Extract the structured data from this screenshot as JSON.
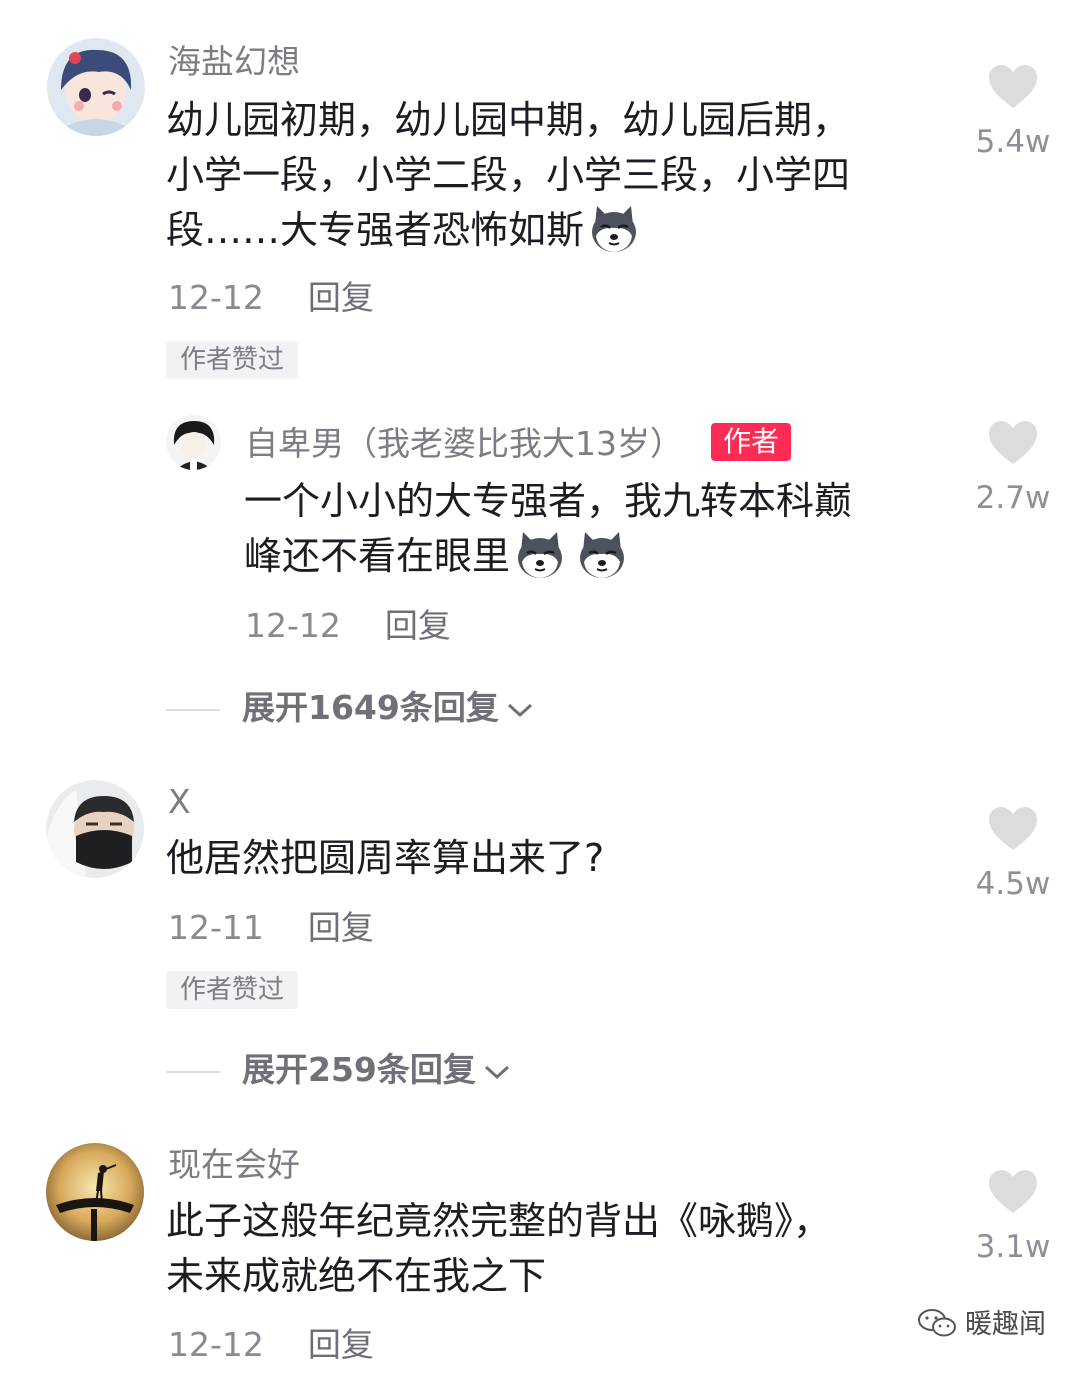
{
  "comments": [
    {
      "username": "海盐幻想",
      "line1": "幼儿园初期，幼儿园中期，幼儿园后期，",
      "line2": "小学一段，小学二段，小学三段，小学四",
      "line3": "段……大专强者恐怖如斯",
      "date": "12-12",
      "reply": "回复",
      "badge": "作者赞过",
      "likes": "5.4w",
      "emoji": "dog-emoji"
    },
    {
      "username": "自卑男（我老婆比我大13岁）",
      "author_tag": "作者",
      "line1": "一个小小的大专强者，我九转本科巅",
      "line2": "峰还不看在眼里",
      "date": "12-12",
      "reply": "回复",
      "likes": "2.7w",
      "emoji": "dog-emoji"
    },
    {
      "username": "X",
      "line1": "他居然把圆周率算出来了?",
      "date": "12-11",
      "reply": "回复",
      "badge": "作者赞过",
      "likes": "4.5w"
    },
    {
      "username": "现在会好",
      "line1": "此子这般年纪竟然完整的背出《咏鹅》，",
      "line2": "未来成就绝不在我之下",
      "date": "12-12",
      "reply": "回复",
      "likes": "3.1w"
    }
  ],
  "expanders": [
    {
      "label": "展开1649条回复"
    },
    {
      "label": "展开259条回复"
    }
  ],
  "watermark": "暖趣闻",
  "colors": {
    "like_icon": "#dcdcdf",
    "author_tag": "#fe2c55",
    "username": "#7b7c84"
  }
}
